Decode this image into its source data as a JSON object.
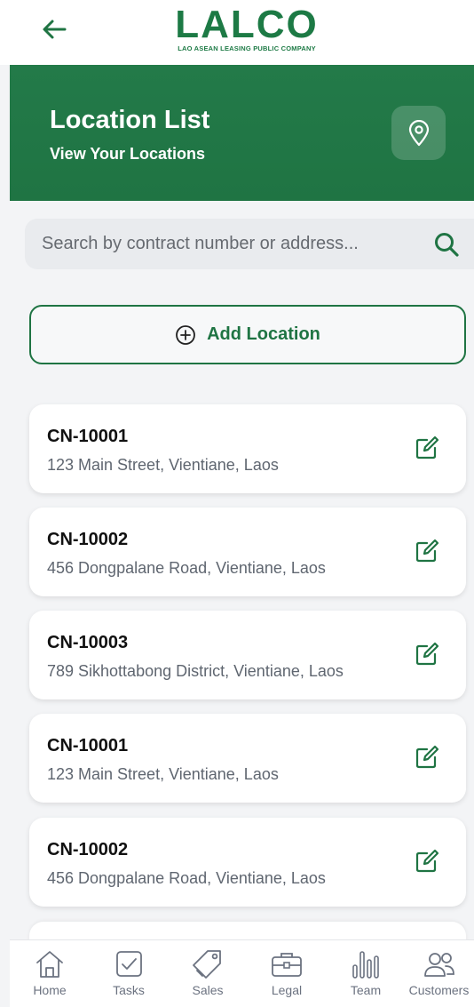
{
  "header": {
    "logo_text": "LALCO",
    "logo_subtitle": "LAO ASEAN LEASING PUBLIC COMPANY",
    "back_icon": "arrow-left-icon"
  },
  "hero": {
    "title": "Location List",
    "subtitle": "View Your Locations",
    "icon": "map-pin-icon"
  },
  "search": {
    "placeholder": "Search by contract number or address...",
    "value": "",
    "icon": "search-icon"
  },
  "add_button": {
    "label": "Add Location",
    "icon": "plus-circle-icon"
  },
  "locations": [
    {
      "contract": "CN-10001",
      "address": "123 Main Street, Vientiane, Laos"
    },
    {
      "contract": "CN-10002",
      "address": "456 Dongpalane Road, Vientiane, Laos"
    },
    {
      "contract": "CN-10003",
      "address": "789 Sikhottabong District, Vientiane, Laos"
    },
    {
      "contract": "CN-10001",
      "address": "123 Main Street, Vientiane, Laos"
    },
    {
      "contract": "CN-10002",
      "address": "456 Dongpalane Road, Vientiane, Laos"
    }
  ],
  "nav": {
    "items": [
      {
        "label": "Home",
        "icon": "home-icon"
      },
      {
        "label": "Tasks",
        "icon": "checkbox-icon"
      },
      {
        "label": "Sales",
        "icon": "tag-icon"
      },
      {
        "label": "Legal",
        "icon": "briefcase-icon"
      },
      {
        "label": "Team",
        "icon": "bar-chart-icon"
      },
      {
        "label": "Customers",
        "icon": "users-icon"
      }
    ]
  },
  "colors": {
    "brand_green": "#1f7443",
    "text_muted": "#5f6670",
    "background": "#f3f4f6"
  }
}
